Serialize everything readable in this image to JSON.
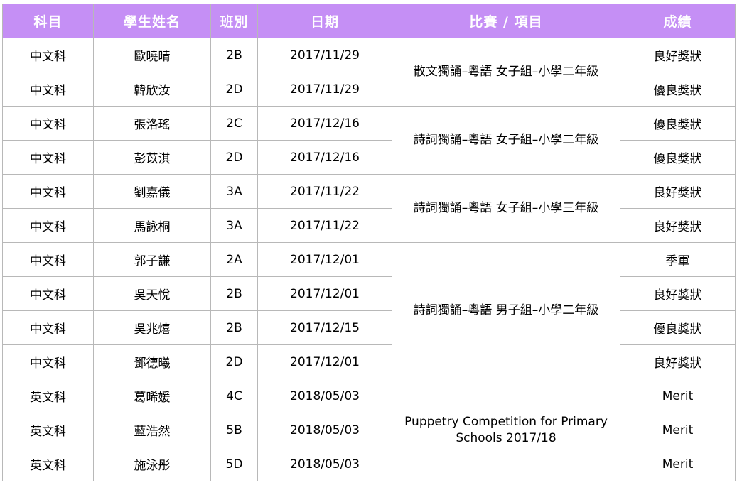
{
  "colors": {
    "header_background": "#c58ff5",
    "header_text": "#ffffff",
    "grid_line": "#b8b8b8"
  },
  "headers": {
    "subject": "科目",
    "name": "學生姓名",
    "class": "班別",
    "date": "日期",
    "event": "比賽 / 項目",
    "result": "成績"
  },
  "rows": [
    {
      "subject": "中文科",
      "name": "歐曉晴",
      "class": "2B",
      "date": "2017/11/29",
      "result": "良好獎狀"
    },
    {
      "subject": "中文科",
      "name": "韓欣汝",
      "class": "2D",
      "date": "2017/11/29",
      "result": "優良獎狀"
    },
    {
      "subject": "中文科",
      "name": "張洛瑤",
      "class": "2C",
      "date": "2017/12/16",
      "result": "優良獎狀"
    },
    {
      "subject": "中文科",
      "name": "彭苡淇",
      "class": "2D",
      "date": "2017/12/16",
      "result": "優良獎狀"
    },
    {
      "subject": "中文科",
      "name": "劉嘉儀",
      "class": "3A",
      "date": "2017/11/22",
      "result": "良好獎狀"
    },
    {
      "subject": "中文科",
      "name": "馬詠桐",
      "class": "3A",
      "date": "2017/11/22",
      "result": "良好獎狀"
    },
    {
      "subject": "中文科",
      "name": "郭子謙",
      "class": "2A",
      "date": "2017/12/01",
      "result": "季軍"
    },
    {
      "subject": "中文科",
      "name": "吳天悅",
      "class": "2B",
      "date": "2017/12/01",
      "result": "良好獎狀"
    },
    {
      "subject": "中文科",
      "name": "吳兆熺",
      "class": "2B",
      "date": "2017/12/15",
      "result": "優良獎狀"
    },
    {
      "subject": "中文科",
      "name": "鄧德曦",
      "class": "2D",
      "date": "2017/12/01",
      "result": "良好獎狀"
    },
    {
      "subject": "英文科",
      "name": "葛晞媛",
      "class": "4C",
      "date": "2018/05/03",
      "result": "Merit"
    },
    {
      "subject": "英文科",
      "name": "藍浩然",
      "class": "5B",
      "date": "2018/05/03",
      "result": "Merit"
    },
    {
      "subject": "英文科",
      "name": "施泳彤",
      "class": "5D",
      "date": "2018/05/03",
      "result": "Merit"
    }
  ],
  "events": [
    {
      "label": "散文獨誦–粵語  女子組–小學二年級"
    },
    {
      "label": "詩詞獨誦–粵語  女子組–小學二年級"
    },
    {
      "label": "詩詞獨誦–粵語  女子組–小學三年級"
    },
    {
      "label": "詩詞獨誦–粵語  男子組–小學二年級"
    },
    {
      "label": "Puppetry Competition for Primary Schools 2017/18"
    }
  ]
}
